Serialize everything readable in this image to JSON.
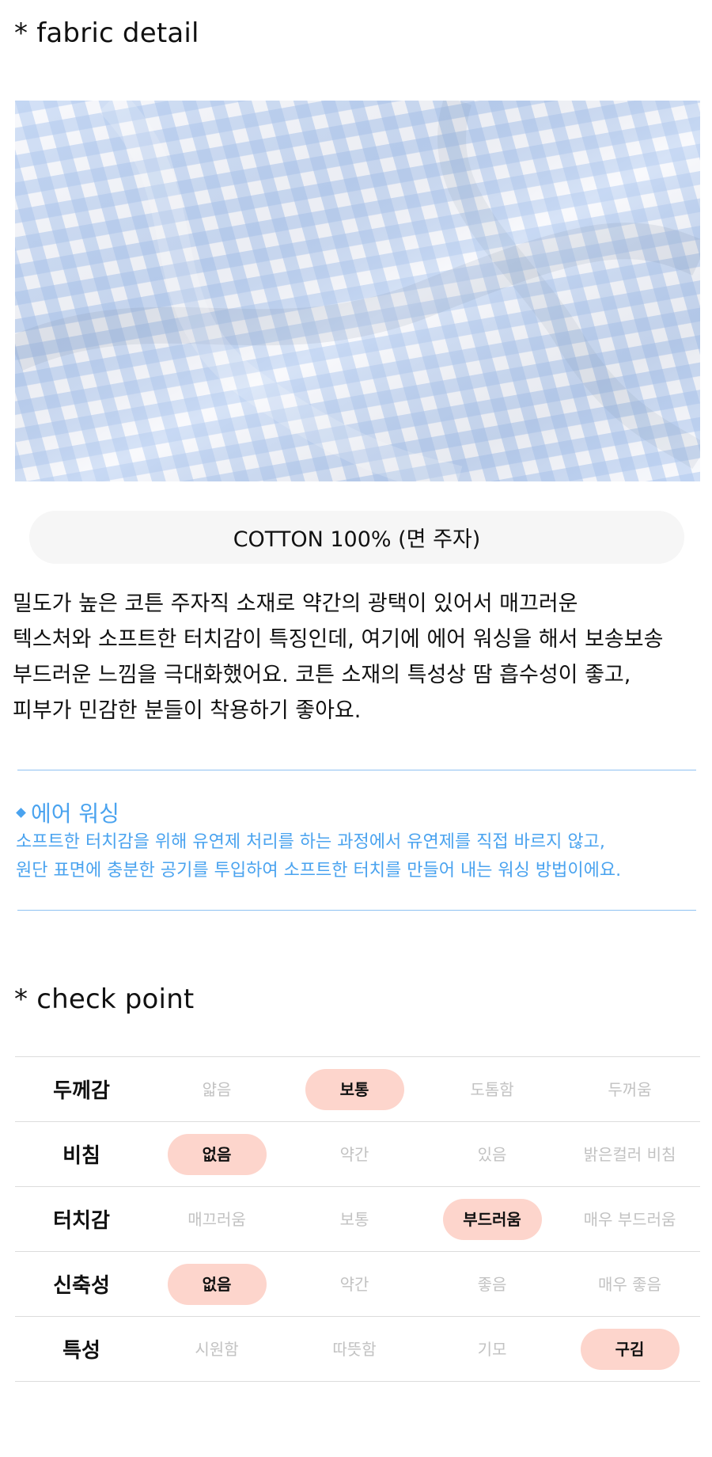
{
  "fabric_detail": {
    "heading": "* fabric detail",
    "photo_colors": {
      "base": "#f7f8fc",
      "check": "#a9c4ee"
    },
    "composition": "COTTON 100% (면 주자)",
    "description_lines": [
      "밀도가 높은 코튼 주자직 소재로 약간의 광택이 있어서 매끄러운",
      "텍스처와 소프트한 터치감이 특징인데, 여기에 에어 워싱을 해서 보송보송",
      "부드러운 느낌을 극대화했어요. 코튼 소재의 특성상 땀 흡수성이 좋고,",
      "피부가 민감한 분들이 착용하기 좋아요."
    ]
  },
  "air_washing_note": {
    "title": "에어 워싱",
    "lines": [
      "소프트한 터치감을 위해 유연제 처리를 하는 과정에서 유연제를 직접 바르지 않고,",
      "원단 표면에 충분한 공기를 투입하여 소프트한 터치를 만들어 내는 워싱 방법이에요."
    ],
    "accent_color": "#4aa3ef"
  },
  "check_point": {
    "heading": "* check point",
    "highlight_color": "#fdd5cc",
    "rows": [
      {
        "label": "두께감",
        "options": [
          "얇음",
          "보통",
          "도톰함",
          "두꺼움"
        ],
        "selected": 1
      },
      {
        "label": "비침",
        "options": [
          "없음",
          "약간",
          "있음",
          "밝은컬러 비침"
        ],
        "selected": 0
      },
      {
        "label": "터치감",
        "options": [
          "매끄러움",
          "보통",
          "부드러움",
          "매우 부드러움"
        ],
        "selected": 2
      },
      {
        "label": "신축성",
        "options": [
          "없음",
          "약간",
          "좋음",
          "매우 좋음"
        ],
        "selected": 0
      },
      {
        "label": "특성",
        "options": [
          "시원함",
          "따뜻함",
          "기모",
          "구김"
        ],
        "selected": 3
      }
    ]
  }
}
